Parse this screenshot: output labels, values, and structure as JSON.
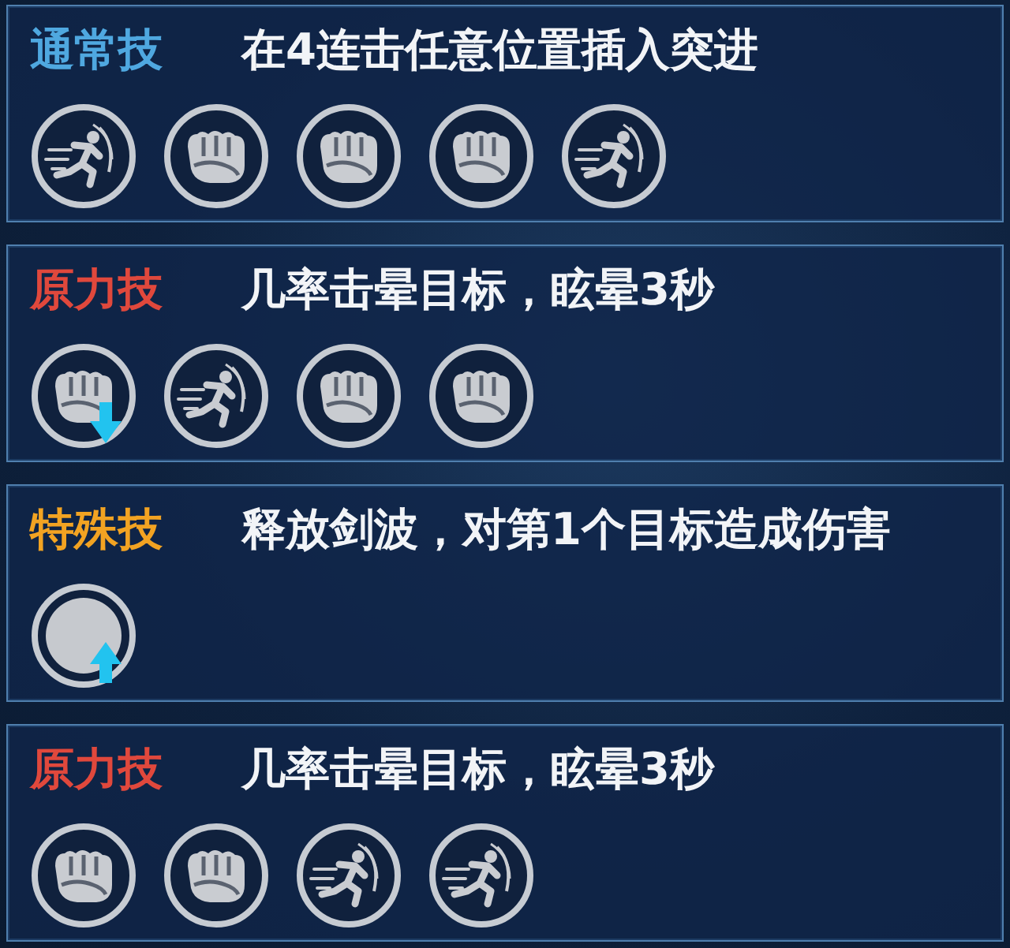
{
  "sections": [
    {
      "title": "通常技",
      "color": "#4fa8e0",
      "description": "在4连击任意位置插入突进",
      "icons": [
        {
          "kind": "runner"
        },
        {
          "kind": "fist"
        },
        {
          "kind": "fist"
        },
        {
          "kind": "fist"
        },
        {
          "kind": "runner"
        }
      ]
    },
    {
      "title": "原力技",
      "color": "#e0483c",
      "description": "几率击晕目标，眩晕3秒",
      "icons": [
        {
          "kind": "fist",
          "arrow_down": true
        },
        {
          "kind": "runner"
        },
        {
          "kind": "fist"
        },
        {
          "kind": "fist"
        }
      ]
    },
    {
      "title": "特殊技",
      "color": "#f2a322",
      "description": "释放剑波，对第1个目标造成伤害",
      "icons": [
        {
          "kind": "disc",
          "arrow_up": true
        }
      ]
    },
    {
      "title": "原力技",
      "color": "#e0483c",
      "description": "几率击晕目标，眩晕3秒",
      "icons": [
        {
          "kind": "fist"
        },
        {
          "kind": "fist"
        },
        {
          "kind": "runner"
        },
        {
          "kind": "runner"
        }
      ]
    }
  ]
}
